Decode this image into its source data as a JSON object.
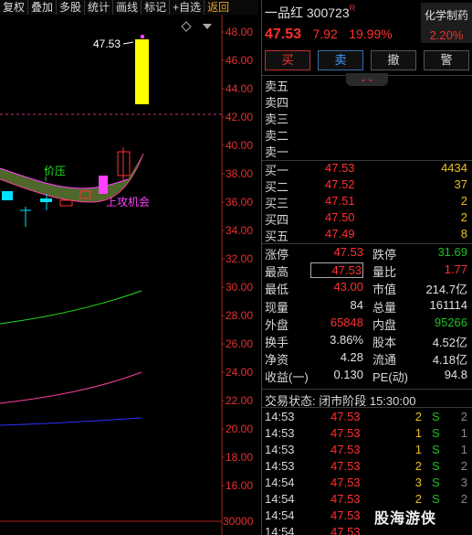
{
  "toolbar": [
    {
      "label": "复权",
      "name": "restore-rights-button"
    },
    {
      "label": "叠加",
      "name": "overlay-button"
    },
    {
      "label": "多股",
      "name": "multi-stock-button"
    },
    {
      "label": "统计",
      "name": "statistics-button"
    },
    {
      "label": "画线",
      "name": "draw-line-button"
    },
    {
      "label": "标记",
      "name": "mark-button"
    },
    {
      "label": "+自选",
      "name": "add-watchlist-button"
    },
    {
      "label": "返回",
      "name": "back-button"
    }
  ],
  "chart": {
    "price_axis": [
      "48.00",
      "46.00",
      "44.00",
      "42.00",
      "40.00",
      "38.00",
      "36.00",
      "34.00",
      "32.00",
      "30.00",
      "28.00",
      "26.00",
      "24.00",
      "22.00",
      "20.00",
      "18.00",
      "16.00"
    ],
    "volume_label": "30000",
    "high_marker": "47.53",
    "annotation_pressure": "价压",
    "annotation_opportunity": "上攻机会",
    "colors": {
      "up": "#ff3030",
      "down": "#00e0ff",
      "limit_bar": "#ffff00",
      "ma_green": "#20e020",
      "ma_pink": "#ff40a0",
      "ma_blue": "#3030ff",
      "dashed": "#c03080"
    }
  },
  "stock": {
    "name": "一品红",
    "code": "300723",
    "tag": "R",
    "sector_name": "化学制药",
    "sector_pct": "2.20%",
    "last_price": "47.53",
    "change_abs": "7.92",
    "change_pct": "19.99%"
  },
  "actions": {
    "buy": "买",
    "sell": "卖",
    "cancel": "撤",
    "alert": "警",
    "collapse": "⌄⌄"
  },
  "asks": [
    {
      "label": "卖五",
      "price": "",
      "vol": ""
    },
    {
      "label": "卖四",
      "price": "",
      "vol": ""
    },
    {
      "label": "卖三",
      "price": "",
      "vol": ""
    },
    {
      "label": "卖二",
      "price": "",
      "vol": ""
    },
    {
      "label": "卖一",
      "price": "",
      "vol": ""
    }
  ],
  "bids": [
    {
      "label": "买一",
      "price": "47.53",
      "vol": "4434"
    },
    {
      "label": "买二",
      "price": "47.52",
      "vol": "37"
    },
    {
      "label": "买三",
      "price": "47.51",
      "vol": "2"
    },
    {
      "label": "买四",
      "price": "47.50",
      "vol": "2"
    },
    {
      "label": "买五",
      "price": "47.49",
      "vol": "8"
    }
  ],
  "stats": [
    {
      "l1": "涨停",
      "v1": "47.53",
      "c1": "red",
      "l2": "跌停",
      "v2": "31.69",
      "c2": "green"
    },
    {
      "l1": "最高",
      "v1": "47.53",
      "c1": "red boxed",
      "l2": "量比",
      "v2": "1.77",
      "c2": "red"
    },
    {
      "l1": "最低",
      "v1": "43.00",
      "c1": "red",
      "l2": "市值",
      "v2": "214.7亿",
      "c2": "white"
    },
    {
      "l1": "现量",
      "v1": "84",
      "c1": "white",
      "l2": "总量",
      "v2": "161114",
      "c2": "white"
    },
    {
      "l1": "外盘",
      "v1": "65848",
      "c1": "red",
      "l2": "内盘",
      "v2": "95266",
      "c2": "green"
    },
    {
      "l1": "换手",
      "v1": "3.86%",
      "c1": "white",
      "l2": "股本",
      "v2": "4.52亿",
      "c2": "white"
    },
    {
      "l1": "净资",
      "v1": "4.28",
      "c1": "white",
      "l2": "流通",
      "v2": "4.18亿",
      "c2": "white"
    },
    {
      "l1": "收益(一)",
      "v1": "0.130",
      "c1": "white",
      "l2": "PE(动)",
      "v2": "94.8",
      "c2": "white"
    }
  ],
  "trade_status": "交易状态: 闭市阶段 15:30:00",
  "ticks": [
    {
      "time": "14:53",
      "price": "47.53",
      "vol": "2",
      "bs": "S",
      "n": "2"
    },
    {
      "time": "14:53",
      "price": "47.53",
      "vol": "1",
      "bs": "S",
      "n": "1"
    },
    {
      "time": "14:53",
      "price": "47.53",
      "vol": "1",
      "bs": "S",
      "n": "1"
    },
    {
      "time": "14:53",
      "price": "47.53",
      "vol": "2",
      "bs": "S",
      "n": "2"
    },
    {
      "time": "14:54",
      "price": "47.53",
      "vol": "3",
      "bs": "S",
      "n": "3"
    },
    {
      "time": "14:54",
      "price": "47.53",
      "vol": "2",
      "bs": "S",
      "n": "2"
    },
    {
      "time": "14:54",
      "price": "47.53",
      "vol": "",
      "bs": "",
      "n": ""
    },
    {
      "time": "14:54",
      "price": "47.53",
      "vol": "",
      "bs": "",
      "n": ""
    }
  ],
  "watermark": "股海游侠"
}
